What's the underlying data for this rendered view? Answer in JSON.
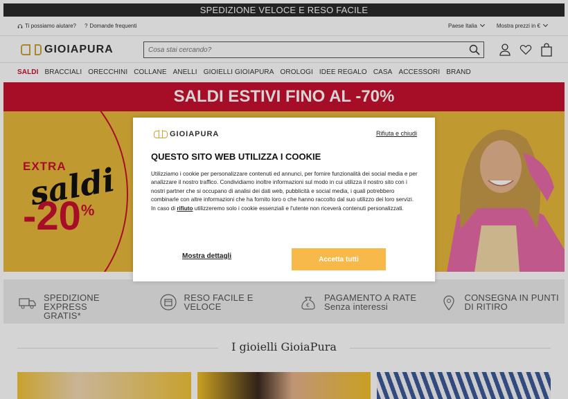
{
  "promo_bar": "SPEDIZIONE VELOCE E RESO FACILE",
  "util": {
    "help": "Ti possiamo aiutare?",
    "faq": "Domande frequenti",
    "country": "Paese Italia",
    "currency": "Mostra prezzi in €"
  },
  "header": {
    "logo": "GIOIAPURA",
    "search_placeholder": "Cosa stai cercando?"
  },
  "nav": [
    "SALDI",
    "BRACCIALI",
    "ORECCHINI",
    "COLLANE",
    "ANELLI",
    "GIOIELLI GIOIAPURA",
    "OROLOGI",
    "IDEE REGALO",
    "CASA",
    "ACCESSORI",
    "BRAND"
  ],
  "sale_banner": "SALDI ESTIVI FINO AL -70%",
  "hero": {
    "extra": "EXTRA",
    "saldi": "saldi",
    "discount": "-20",
    "percent": "%"
  },
  "features": [
    {
      "icon": "truck-icon",
      "line1": "SPEDIZIONE EXPRESS",
      "line2": "GRATIS*"
    },
    {
      "icon": "return-box-icon",
      "line1": "RESO FACILE E",
      "line2": "VELOCE"
    },
    {
      "icon": "money-bag-icon",
      "line1": "PAGAMENTO A RATE",
      "line2": "Senza interessi"
    },
    {
      "icon": "location-pin-icon",
      "line1": "CONSEGNA IN PUNTI",
      "line2": "DI RITIRO"
    }
  ],
  "section_title": "I gioielli GioiaPura",
  "cookie_modal": {
    "logo": "GIOIAPURA",
    "reject": "Rifiuta e chiudi",
    "title": "QUESTO SITO WEB UTILIZZA I COOKIE",
    "body1": "Utilizziamo i cookie per personalizzare contenuti ed annunci, per fornire funzionalità dei social media e per analizzare il nostro traffico. Condividiamo inoltre informazioni sul modo in cui utilizza il nostro sito con i nostri partner che si occupano di analisi dei dati web, pubblicità e social media, i quali potrebbero combinarle con altre informazioni che ha fornito loro o che hanno raccolto dal suo utilizzo dei loro servizi.",
    "body2_pre": "In caso di ",
    "body2_link": "rifiuto",
    "body2_post": " utilizzeremo solo i cookie essenziali e l'utente non riceverà contenuti personalizzati.",
    "details": "Mostra dettagli",
    "accept": "Accetta tutti"
  },
  "colors": {
    "sale_red": "#c8102e",
    "hero_yellow": "#e8b83c",
    "accept_button": "#f6b94a",
    "logo_gold": "#c9a43c"
  }
}
